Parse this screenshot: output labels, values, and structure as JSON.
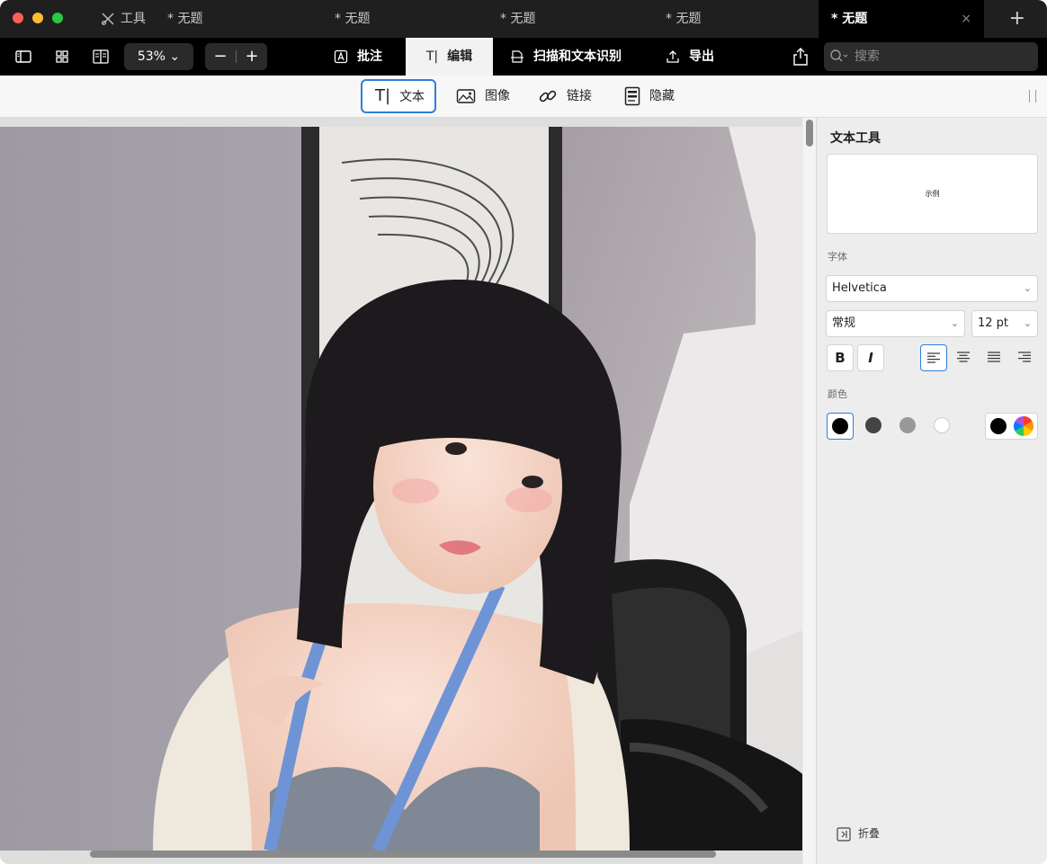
{
  "tabs": [
    {
      "label": "工具"
    },
    {
      "label": "* 无题"
    },
    {
      "label": "* 无题"
    },
    {
      "label": "* 无题"
    },
    {
      "label": "* 无题"
    },
    {
      "label": "* 无题"
    }
  ],
  "tab_close": "×",
  "tab_add": "+",
  "toolbar": {
    "zoom_label": "53% ⌄",
    "zoom_out": "−",
    "zoom_in": "+",
    "modes": [
      "批注",
      "编辑",
      "扫描和文本识别",
      "导出"
    ],
    "search_placeholder": "搜索"
  },
  "edit_tools": [
    "文本",
    "图像",
    "链接",
    "隐藏"
  ],
  "inspector": {
    "title": "文本工具",
    "preview_text": "示例",
    "font_label": "字体",
    "font_family": "Helvetica",
    "font_style": "常规",
    "font_size": "12 pt",
    "bold": "B",
    "italic": "I",
    "color_label": "颜色",
    "colors": [
      "#000000",
      "#444444",
      "#999999",
      "#ffffff"
    ],
    "custom_color": "#000000",
    "fold_label": "折叠"
  },
  "accent_color": "#2f7ed8"
}
